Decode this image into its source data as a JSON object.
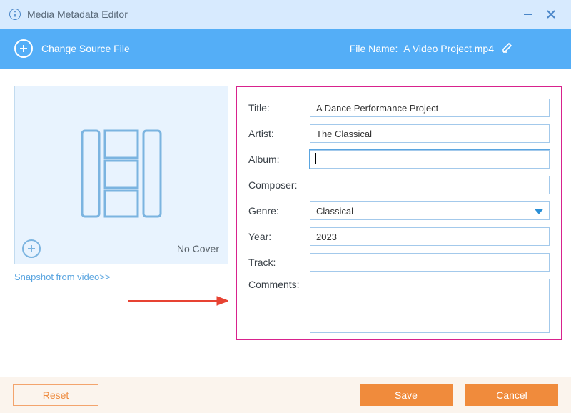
{
  "app": {
    "title": "Media Metadata Editor"
  },
  "toolbar": {
    "change_source": "Change Source File",
    "file_name_label": "File Name:",
    "file_name_value": "A Video Project.mp4"
  },
  "cover": {
    "no_cover": "No Cover",
    "snapshot_link": "Snapshot from video>>"
  },
  "form": {
    "labels": {
      "title": "Title:",
      "artist": "Artist:",
      "album": "Album:",
      "composer": "Composer:",
      "genre": "Genre:",
      "year": "Year:",
      "track": "Track:",
      "comments": "Comments:"
    },
    "values": {
      "title": "A Dance Performance Project",
      "artist": "The Classical",
      "album": "",
      "composer": "",
      "genre": "Classical",
      "year": "2023",
      "track": "",
      "comments": ""
    }
  },
  "footer": {
    "reset": "Reset",
    "save": "Save",
    "cancel": "Cancel"
  }
}
